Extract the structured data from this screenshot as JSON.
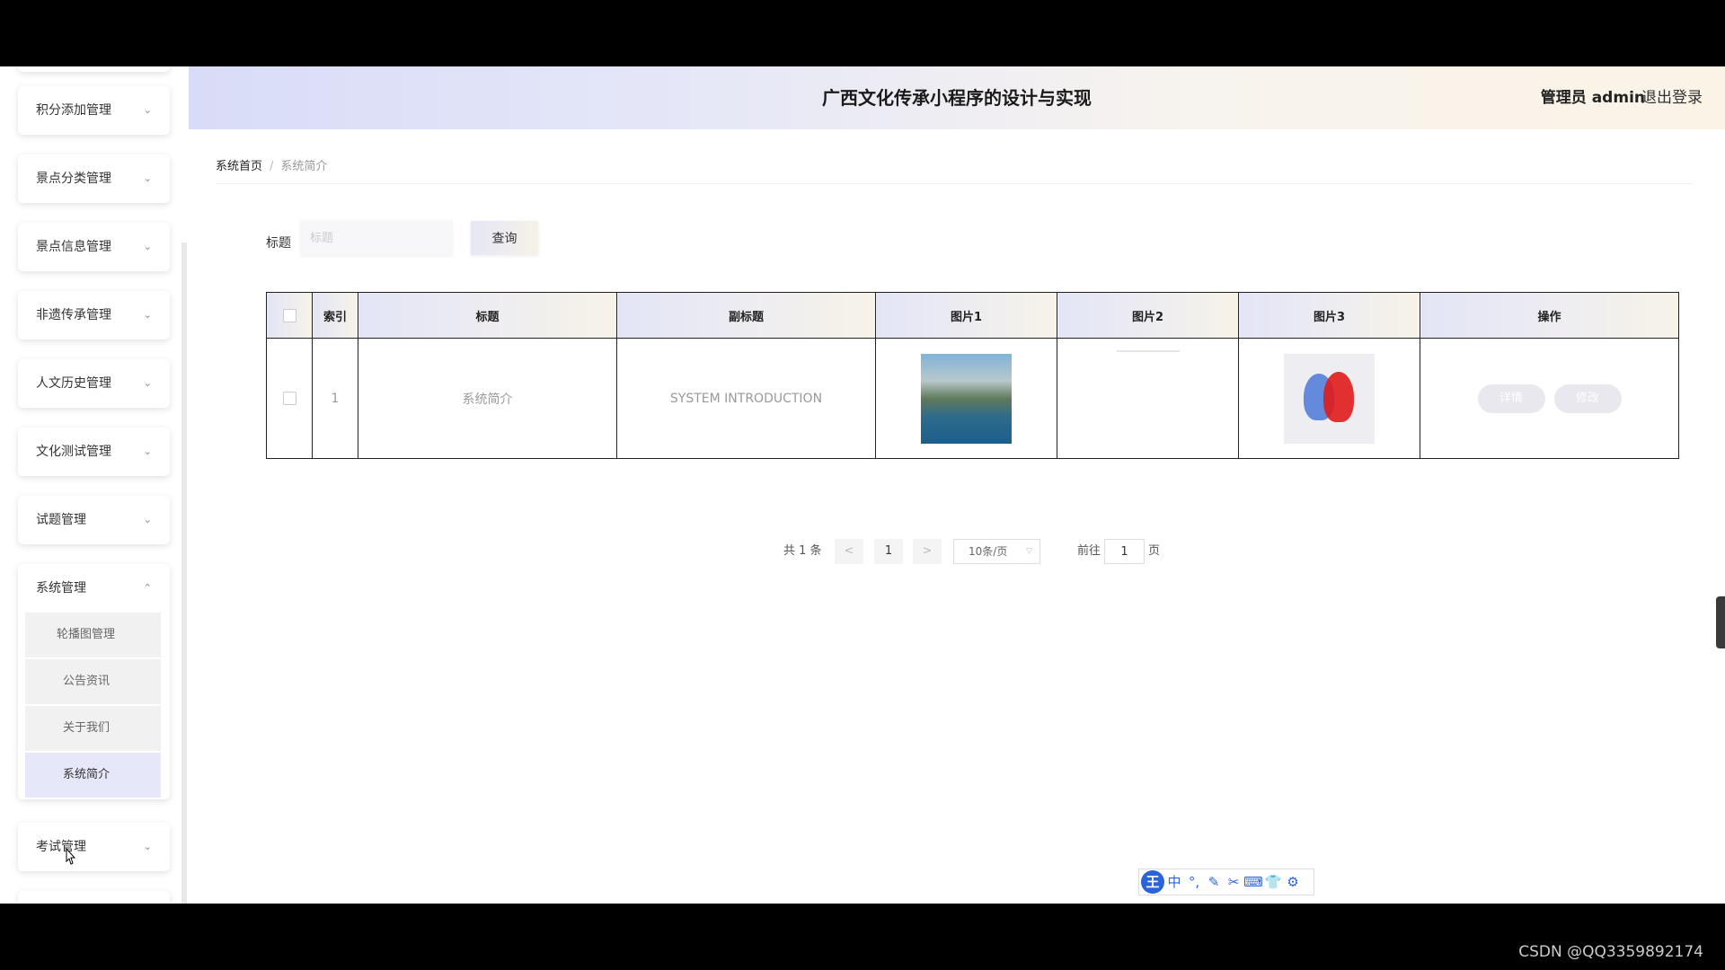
{
  "header": {
    "title": "广西文化传承小程序的设计与实现",
    "user": "管理员 admin",
    "logout": "退出登录"
  },
  "sidebar": {
    "items": [
      {
        "label": "积分添加管理",
        "chevron": "⌄"
      },
      {
        "label": "景点分类管理",
        "chevron": "⌄"
      },
      {
        "label": "景点信息管理",
        "chevron": "⌄"
      },
      {
        "label": "非遗传承管理",
        "chevron": "⌄"
      },
      {
        "label": "人文历史管理",
        "chevron": "⌄"
      },
      {
        "label": "文化测试管理",
        "chevron": "⌄"
      },
      {
        "label": "试题管理",
        "chevron": "⌄"
      },
      {
        "label": "系统管理",
        "chevron": "⌃"
      },
      {
        "label": "考试管理",
        "chevron": "⌄"
      }
    ],
    "submenu": [
      "轮播图管理",
      "公告资讯",
      "关于我们",
      "系统简介"
    ]
  },
  "breadcrumb": {
    "home": "系统首页",
    "separator": "/",
    "current": "系统简介"
  },
  "search": {
    "label": "标题",
    "placeholder": "标题",
    "button": "查询"
  },
  "table": {
    "headers": [
      "索引",
      "标题",
      "副标题",
      "图片1",
      "图片2",
      "图片3",
      "操作"
    ],
    "rows": [
      {
        "index": "1",
        "title": "系统简介",
        "subtitle": "SYSTEM INTRODUCTION",
        "detail": "详情",
        "edit": "修改"
      }
    ]
  },
  "pagination": {
    "total": "共 1 条",
    "prev": "<",
    "page": "1",
    "next": ">",
    "page_size": "10条/页",
    "goto_label": "前往",
    "goto_value": "1",
    "page_unit": "页"
  },
  "ime_toolbar": {
    "logo": "王",
    "mode": "中",
    "punct": "°,",
    "pen": "✎",
    "scissors": "✂",
    "keyboard": "⌨",
    "skin": "👕",
    "settings": "⚙"
  },
  "watermark": "CSDN @QQ3359892174",
  "colors": {
    "header_gradient_start": "#d9dcf7",
    "header_gradient_end": "#fbf3e6",
    "submenu_active": "#e6e7f8"
  }
}
